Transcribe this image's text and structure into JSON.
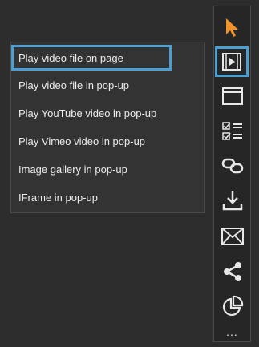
{
  "menu": {
    "items": [
      {
        "label": "Play video file on page",
        "selected": true
      },
      {
        "label": "Play video file in pop-up"
      },
      {
        "label": "Play YouTube video in pop-up"
      },
      {
        "label": "Play Vimeo video in pop-up"
      },
      {
        "label": "Image gallery in pop-up"
      },
      {
        "label": "IFrame in pop-up"
      }
    ]
  },
  "toolbar": {
    "tools": [
      {
        "icon": "cursor-arrow-icon"
      },
      {
        "icon": "video-play-icon",
        "active": true
      },
      {
        "icon": "window-icon"
      },
      {
        "icon": "checklist-icon"
      },
      {
        "icon": "link-icon"
      },
      {
        "icon": "download-icon"
      },
      {
        "icon": "envelope-icon"
      },
      {
        "icon": "share-icon"
      },
      {
        "icon": "pie-chart-icon"
      }
    ],
    "more_label": "..."
  },
  "colors": {
    "accent_blue": "#4a9fd3",
    "accent_orange": "#f0932b",
    "text": "#ececec",
    "background": "#2d2d2d"
  }
}
